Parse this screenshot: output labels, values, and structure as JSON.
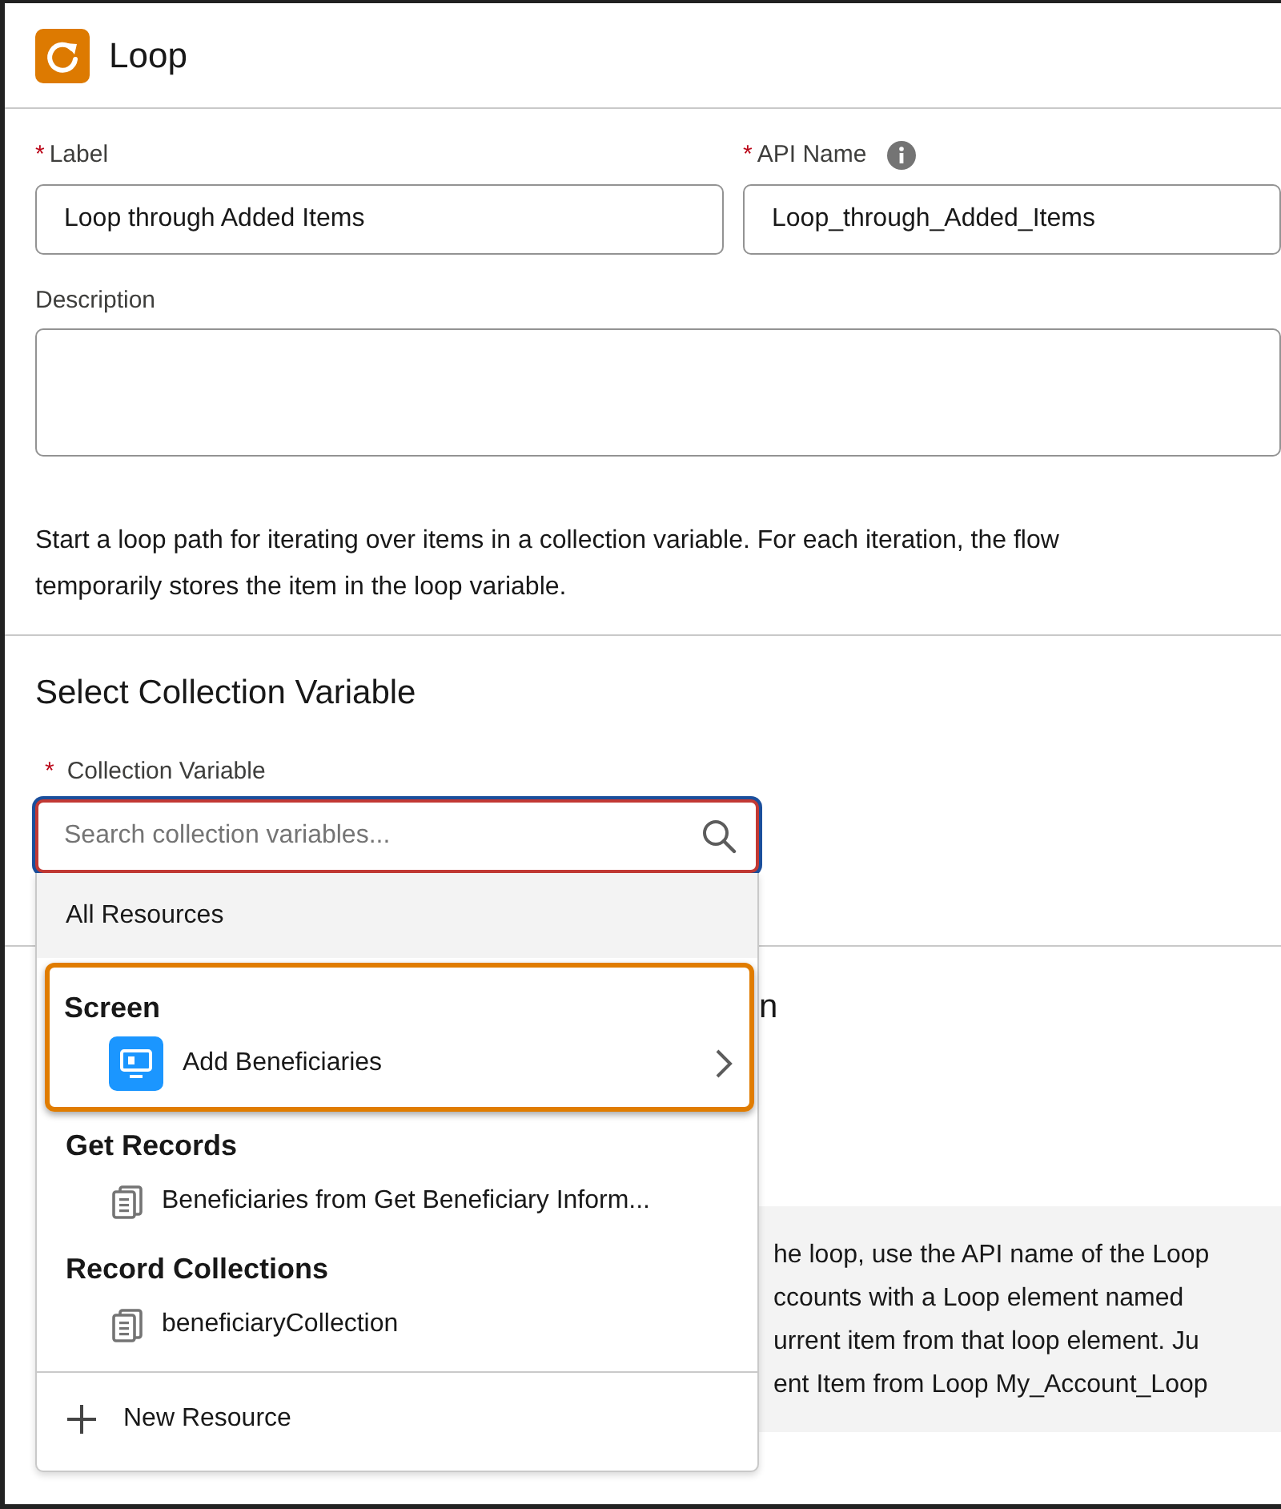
{
  "panel": {
    "title": "Loop"
  },
  "fields": [
    {
      "kind": "input",
      "label": "Label",
      "required_mark": "*",
      "value": "Loop through Added Items"
    },
    {
      "kind": "input",
      "label": "API Name",
      "required_mark": "*",
      "info": true,
      "value": "Loop_through_Added_Items"
    },
    {
      "kind": "textarea",
      "label": "Description"
    }
  ],
  "help_text": [
    "Start a loop path for iterating over items in a collection variable. For each iteration, the flow",
    "temporarily stores the item in the loop variable."
  ],
  "collection_section": {
    "heading": "Select Collection Variable",
    "field": {
      "label": "Collection Variable",
      "required_mark": "*",
      "placeholder": "Search collection variables...",
      "invalid": true,
      "focused": true
    }
  },
  "dropdown": {
    "header": "All Resources",
    "groups": [
      {
        "title": "Screen",
        "highlighted": true,
        "items": [
          {
            "kind": "screen",
            "label": "Add Beneficiaries",
            "has_submenu": true
          }
        ]
      },
      {
        "title": "Get Records",
        "highlighted": false,
        "items": [
          {
            "kind": "collection",
            "label": "Beneficiaries from Get Beneficiary Inform...",
            "has_submenu": false
          }
        ]
      },
      {
        "title": "Record Collections",
        "highlighted": false,
        "items": [
          {
            "kind": "collection",
            "label": "beneficiaryCollection",
            "has_submenu": false
          }
        ]
      }
    ],
    "footer": "New Resource"
  },
  "covered": {
    "heading": "n",
    "note_lines": [
      "he loop, use the API name of the Loop",
      "ccounts with a Loop element named",
      "urrent item from that loop element. Ju",
      "ent Item from Loop My_Account_Loop"
    ]
  }
}
